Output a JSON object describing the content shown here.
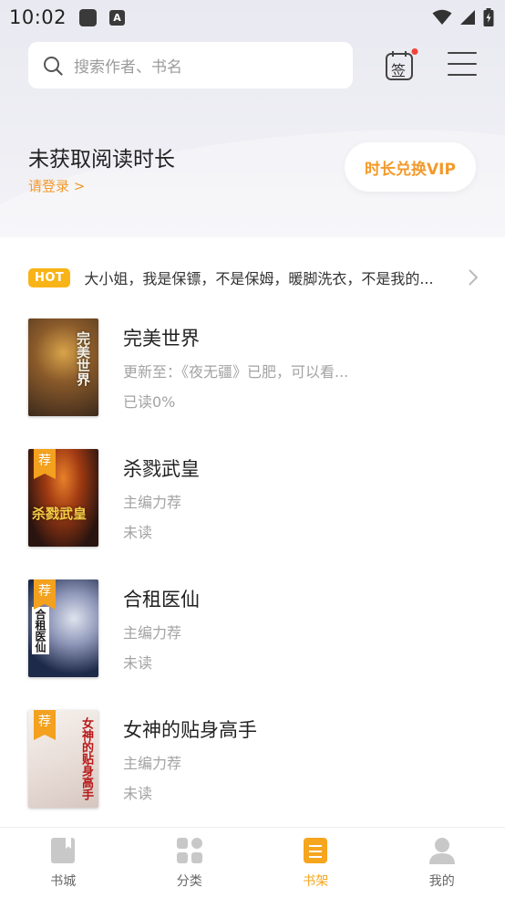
{
  "status": {
    "time": "10:02"
  },
  "header": {
    "search_placeholder": "搜索作者、书名",
    "sign_label": "签"
  },
  "reading": {
    "title": "未获取阅读时长",
    "login_link": "请登录 >",
    "vip_button": "时长兑换VIP"
  },
  "hot": {
    "badge": "HOT",
    "text": "大小姐，我是保镖，不是保姆，暖脚洗衣，不是我的..."
  },
  "books": [
    {
      "title": "完美世界",
      "subtitle": "更新至：《夜无疆》已肥，可以看...",
      "progress": "已读0%",
      "recommended": false,
      "cover_text": "完美世界"
    },
    {
      "title": "杀戮武皇",
      "subtitle": "主编力荐",
      "progress": "未读",
      "recommended": true,
      "rec_label": "荐",
      "cover_text": "杀戮武皇"
    },
    {
      "title": "合租医仙",
      "subtitle": "主编力荐",
      "progress": "未读",
      "recommended": true,
      "rec_label": "荐",
      "cover_text": "合租医仙"
    },
    {
      "title": "女神的贴身高手",
      "subtitle": "主编力荐",
      "progress": "未读",
      "recommended": true,
      "rec_label": "荐",
      "cover_text": "女神的贴身高手"
    }
  ],
  "tabs": [
    {
      "label": "书城",
      "icon": "book-store-icon",
      "active": false
    },
    {
      "label": "分类",
      "icon": "category-grid-icon",
      "active": false
    },
    {
      "label": "书架",
      "icon": "bookshelf-icon",
      "active": true
    },
    {
      "label": "我的",
      "icon": "profile-icon",
      "active": false
    }
  ],
  "colors": {
    "accent": "#f39a2b",
    "hot": "#f8b417",
    "tab_active": "#f6a51e"
  }
}
